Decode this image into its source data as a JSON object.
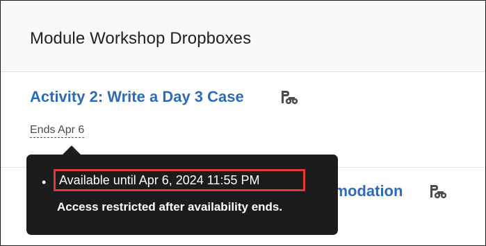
{
  "header": {
    "title": "Module Workshop Dropboxes"
  },
  "activity": {
    "title": "Activity 2: Write a Day 3 Case",
    "ends_label": "Ends Apr 6",
    "icon": "binoculars-icon"
  },
  "next_item": {
    "visible_title_fragment": "nmodation",
    "icon": "binoculars-icon"
  },
  "tooltip": {
    "bullet": "•",
    "availability": "Available until Apr 6, 2024 11:55 PM",
    "restriction": "Access restricted after availability ends."
  },
  "colors": {
    "link": "#2c6bb7",
    "tooltip_bg": "#1c1c1c",
    "highlight_border": "#e53935",
    "header_bg": "#f8f9fb"
  }
}
